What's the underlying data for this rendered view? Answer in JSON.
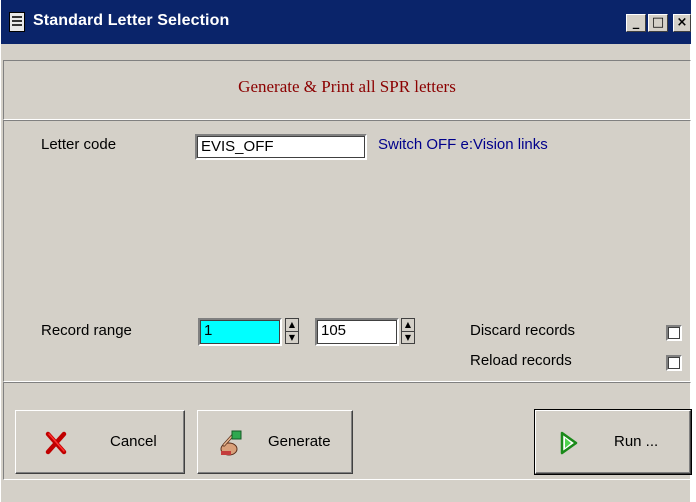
{
  "window": {
    "title": "Standard Letter Selection",
    "controls": {
      "minimize": "_",
      "maximize": "□",
      "close": "×"
    }
  },
  "header": {
    "title": "Generate & Print all SPR letters"
  },
  "letter": {
    "label": "Letter code",
    "code": "EVIS_OFF",
    "description": "Switch OFF e:Vision links"
  },
  "range": {
    "label": "Record range",
    "from": "1",
    "to": "105",
    "spin_up": "▲",
    "spin_down": "▼"
  },
  "options": {
    "discard_label": "Discard records",
    "discard_checked": false,
    "reload_label": "Reload records",
    "reload_checked": false
  },
  "buttons": {
    "cancel": "Cancel",
    "generate": "Generate",
    "run": "Run ..."
  },
  "colors": {
    "titlebar": "#0a246a",
    "face": "#d4d0c8",
    "header_text": "#8b0000",
    "desc_text": "#00008b",
    "selection": "#00ffff"
  }
}
